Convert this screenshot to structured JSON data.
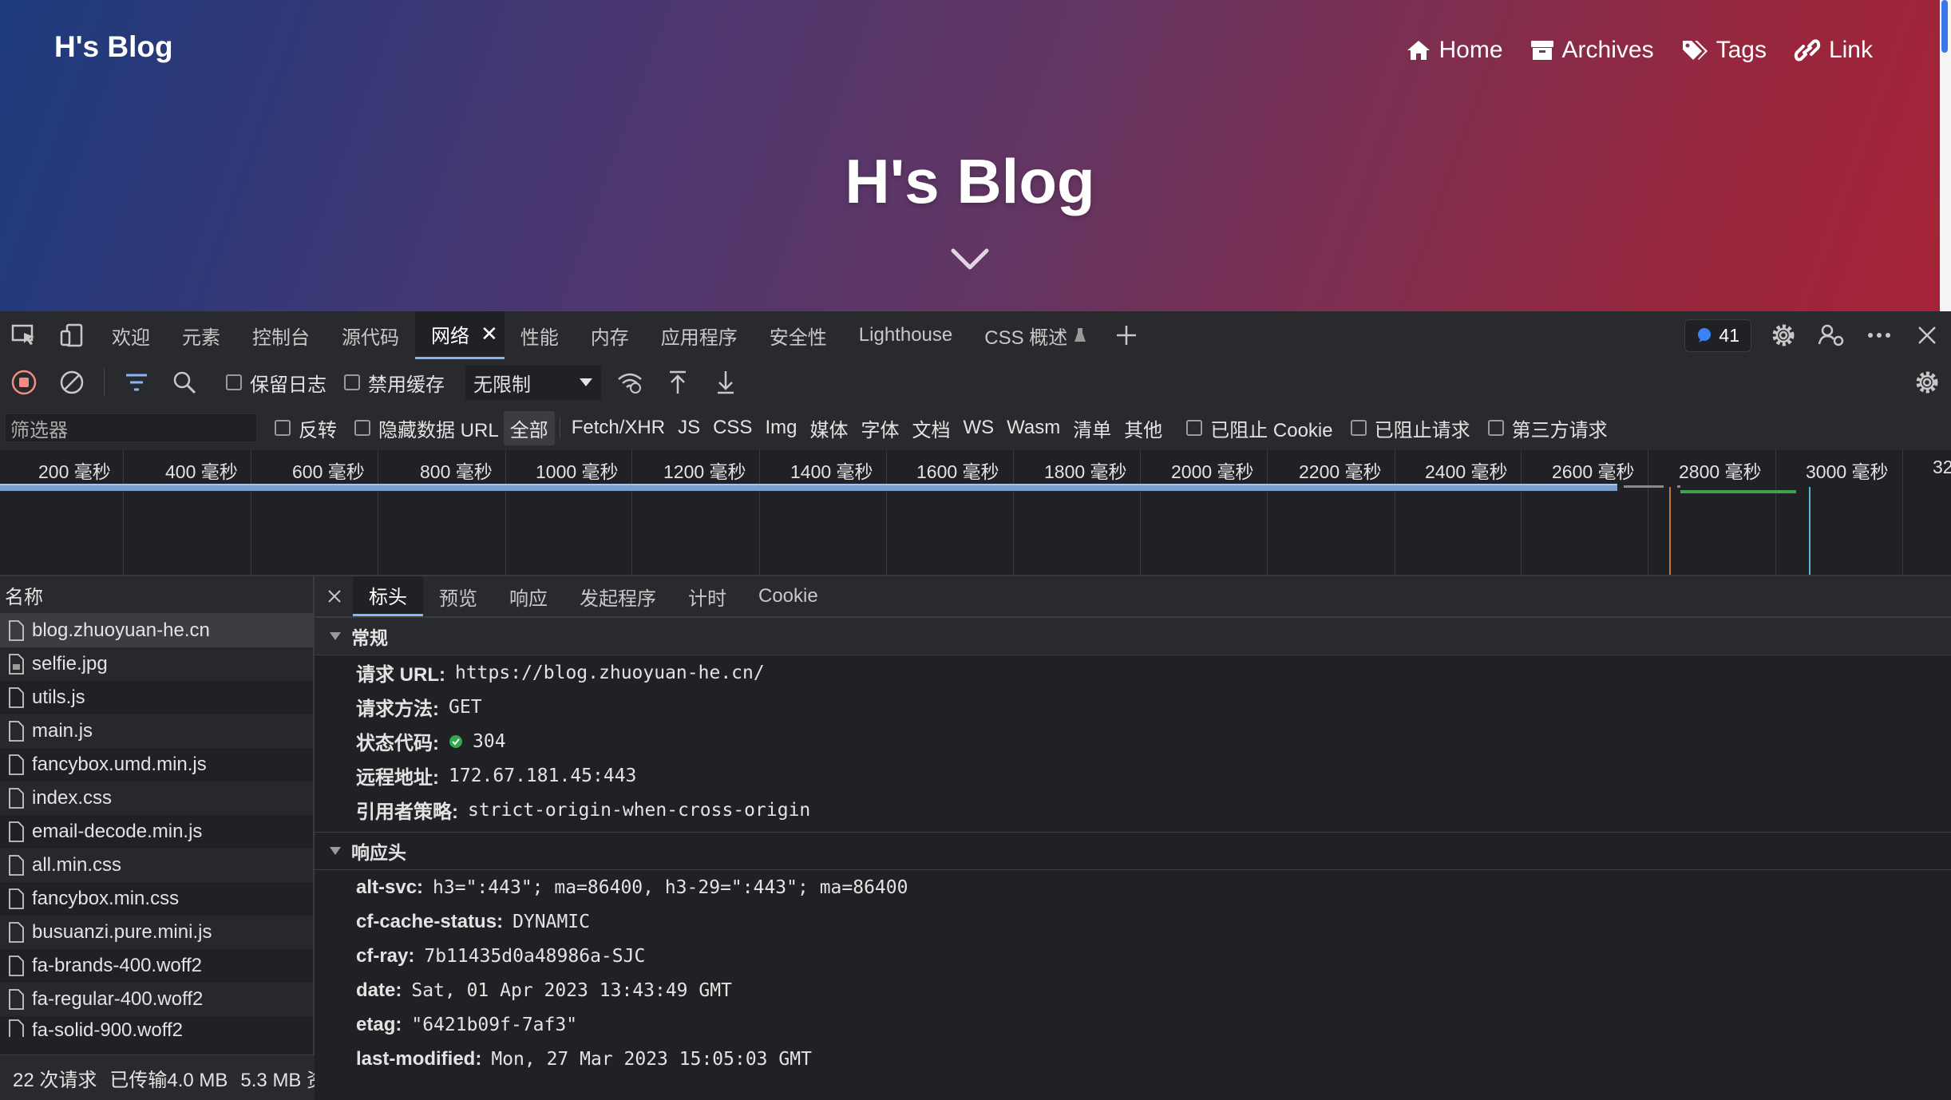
{
  "blog": {
    "site_name": "H's Blog",
    "hero_title": "H's Blog",
    "nav": [
      {
        "label": "Home",
        "icon": "home-icon"
      },
      {
        "label": "Archives",
        "icon": "archive-icon"
      },
      {
        "label": "Tags",
        "icon": "tags-icon"
      },
      {
        "label": "Link",
        "icon": "link-icon"
      }
    ]
  },
  "devtools": {
    "tabs": [
      "欢迎",
      "元素",
      "控制台",
      "源代码",
      "网络",
      "性能",
      "内存",
      "应用程序",
      "安全性",
      "Lighthouse",
      "CSS 概述"
    ],
    "active_tab": "网络",
    "issues_count": "41",
    "toolbar": {
      "preserve_log": "保留日志",
      "disable_cache": "禁用缓存",
      "throttling": "无限制"
    },
    "filter": {
      "placeholder": "筛选器",
      "invert": "反转",
      "hide_data_urls": "隐藏数据 URL",
      "types": [
        "全部",
        "Fetch/XHR",
        "JS",
        "CSS",
        "Img",
        "媒体",
        "字体",
        "文档",
        "WS",
        "Wasm",
        "清单",
        "其他"
      ],
      "active_type": "全部",
      "blocked_cookies": "已阻止 Cookie",
      "blocked_requests": "已阻止请求",
      "third_party": "第三方请求"
    },
    "timeline_labels": [
      "200 毫秒",
      "400 毫秒",
      "600 毫秒",
      "800 毫秒",
      "1000 毫秒",
      "1200 毫秒",
      "1400 毫秒",
      "1600 毫秒",
      "1800 毫秒",
      "2000 毫秒",
      "2200 毫秒",
      "2400 毫秒",
      "2600 毫秒",
      "2800 毫秒",
      "3000 毫秒",
      "32"
    ],
    "requests": {
      "header": "名称",
      "items": [
        "blog.zhuoyuan-he.cn",
        "selfie.jpg",
        "utils.js",
        "main.js",
        "fancybox.umd.min.js",
        "index.css",
        "email-decode.min.js",
        "all.min.css",
        "fancybox.min.css",
        "busuanzi.pure.mini.js",
        "fa-brands-400.woff2",
        "fa-regular-400.woff2",
        "fa-solid-900.woff2"
      ],
      "selected": "blog.zhuoyuan-he.cn"
    },
    "status": {
      "requests": "22 次请求",
      "transferred": "已传输4.0 MB",
      "resources": "5.3 MB 资"
    },
    "detail": {
      "tabs": [
        "标头",
        "预览",
        "响应",
        "发起程序",
        "计时",
        "Cookie"
      ],
      "active_tab": "标头",
      "general": {
        "title": "常规",
        "rows": [
          {
            "k": "请求 URL:",
            "v": "https://blog.zhuoyuan-he.cn/"
          },
          {
            "k": "请求方法:",
            "v": "GET"
          },
          {
            "k": "状态代码:",
            "v": "304"
          },
          {
            "k": "远程地址:",
            "v": "172.67.181.45:443"
          },
          {
            "k": "引用者策略:",
            "v": "strict-origin-when-cross-origin"
          }
        ]
      },
      "response_headers": {
        "title": "响应头",
        "rows": [
          {
            "k": "alt-svc:",
            "v": "h3=\":443\"; ma=86400, h3-29=\":443\"; ma=86400"
          },
          {
            "k": "cf-cache-status:",
            "v": "DYNAMIC"
          },
          {
            "k": "cf-ray:",
            "v": "7b11435d0a48986a-SJC"
          },
          {
            "k": "date:",
            "v": "Sat, 01 Apr 2023 13:43:49 GMT"
          },
          {
            "k": "etag:",
            "v": "\"6421b09f-7af3\""
          },
          {
            "k": "last-modified:",
            "v": "Mon, 27 Mar 2023 15:05:03 GMT"
          }
        ]
      }
    }
  }
}
